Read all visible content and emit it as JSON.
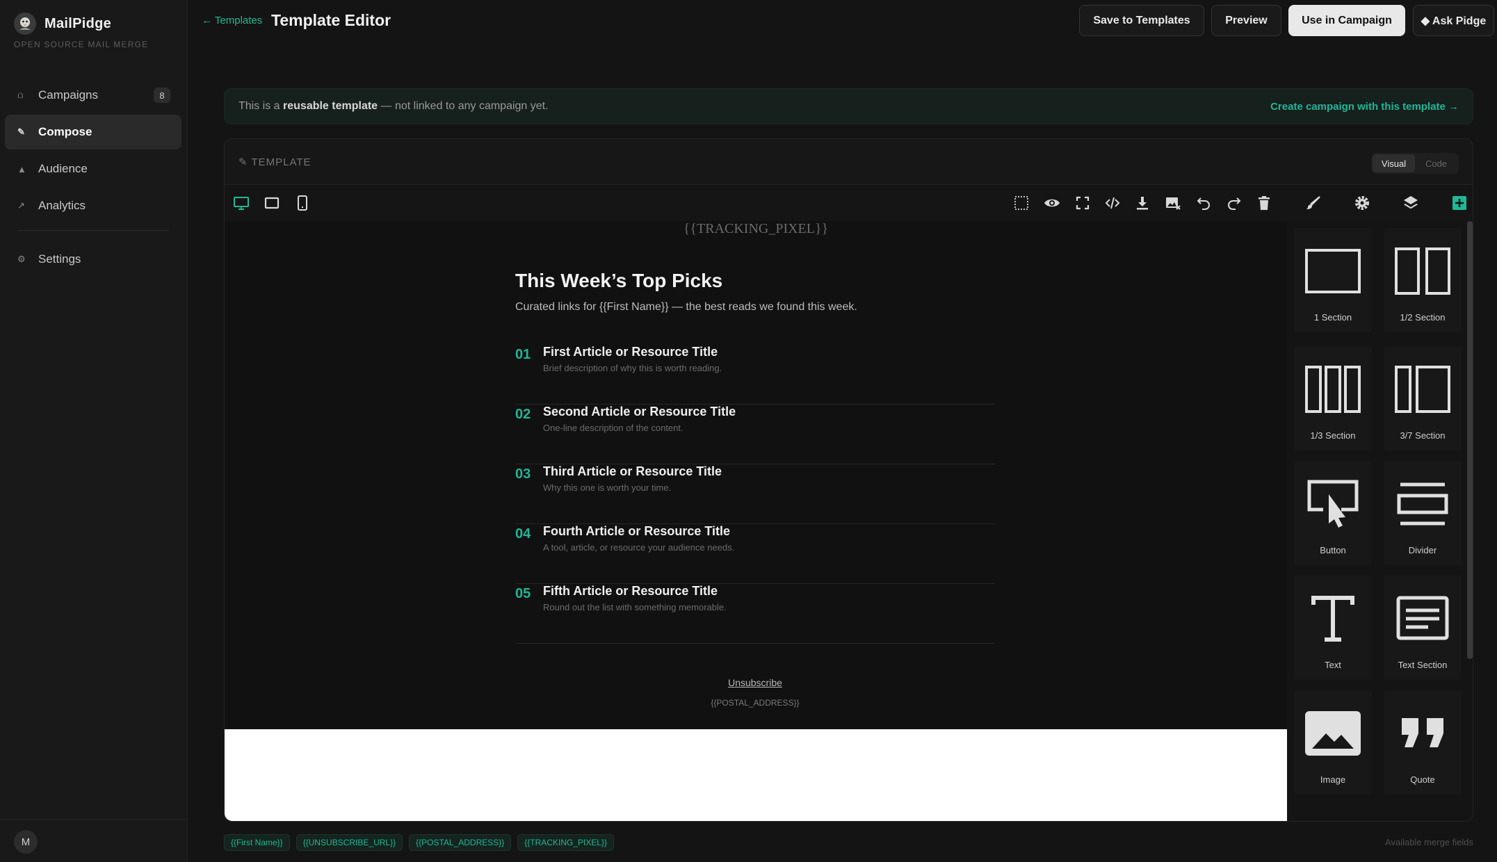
{
  "app": {
    "name": "MailPidge",
    "tagline": "OPEN SOURCE MAIL MERGE",
    "logo_icon": "pigeon-logo"
  },
  "sidebar": {
    "items": [
      {
        "label": "Campaigns",
        "icon": "inbox-icon",
        "badge": "8",
        "active": false
      },
      {
        "label": "Compose",
        "icon": "pencil-icon",
        "active": true
      },
      {
        "label": "Audience",
        "icon": "user-icon",
        "active": false
      },
      {
        "label": "Analytics",
        "icon": "trend-arrow-icon",
        "active": false
      },
      {
        "label": "Settings",
        "icon": "gear-icon",
        "active": false
      }
    ],
    "avatar_initial": "M"
  },
  "header": {
    "back_label": "← Templates",
    "title": "Template Editor",
    "save_label": "Save to Templates",
    "preview_label": "Preview",
    "use_label": "Use in Campaign",
    "ask_label": "◆ Ask Pidge"
  },
  "banner": {
    "prefix": "This is a ",
    "bold": "reusable template",
    "suffix": " — not linked to any campaign yet.",
    "link": "Create campaign with this template →"
  },
  "editor": {
    "label": "TEMPLATE",
    "modes": [
      "Visual",
      "Code"
    ],
    "active_mode": "Visual"
  },
  "email": {
    "tracking": "{{TRACKING_PIXEL}}",
    "title": "This Week’s Top Picks",
    "subtitle": "Curated links for {{First Name}} — the best reads we found this week.",
    "articles": [
      {
        "num": "01",
        "title": "First Article or Resource Title",
        "desc": "Brief description of why this is worth reading."
      },
      {
        "num": "02",
        "title": "Second Article or Resource Title",
        "desc": "One-line description of the content."
      },
      {
        "num": "03",
        "title": "Third Article or Resource Title",
        "desc": "Why this one is worth your time."
      },
      {
        "num": "04",
        "title": "Fourth Article or Resource Title",
        "desc": "A tool, article, or resource your audience needs."
      },
      {
        "num": "05",
        "title": "Fifth Article or Resource Title",
        "desc": "Round out the list with something memorable."
      }
    ],
    "unsubscribe": "Unsubscribe",
    "postal": "{{POSTAL_ADDRESS}}"
  },
  "blocks": [
    {
      "label": "1 Section",
      "icon": "one-section-icon"
    },
    {
      "label": "1/2 Section",
      "icon": "half-section-icon"
    },
    {
      "label": "1/3 Section",
      "icon": "third-section-icon"
    },
    {
      "label": "3/7 Section",
      "icon": "three-seven-section-icon"
    },
    {
      "label": "Button",
      "icon": "button-block-icon"
    },
    {
      "label": "Divider",
      "icon": "divider-block-icon"
    },
    {
      "label": "Text",
      "icon": "text-block-icon"
    },
    {
      "label": "Text Section",
      "icon": "text-section-icon"
    },
    {
      "label": "Image",
      "icon": "image-block-icon"
    },
    {
      "label": "Quote",
      "icon": "quote-block-icon"
    }
  ],
  "merge_fields": [
    "{{First Name}}",
    "{{UNSUBSCRIBE_URL}}",
    "{{POSTAL_ADDRESS}}",
    "{{TRACKING_PIXEL}}"
  ],
  "merge_hint": "Available merge fields",
  "colors": {
    "accent": "#20b797",
    "background": "#141414"
  }
}
